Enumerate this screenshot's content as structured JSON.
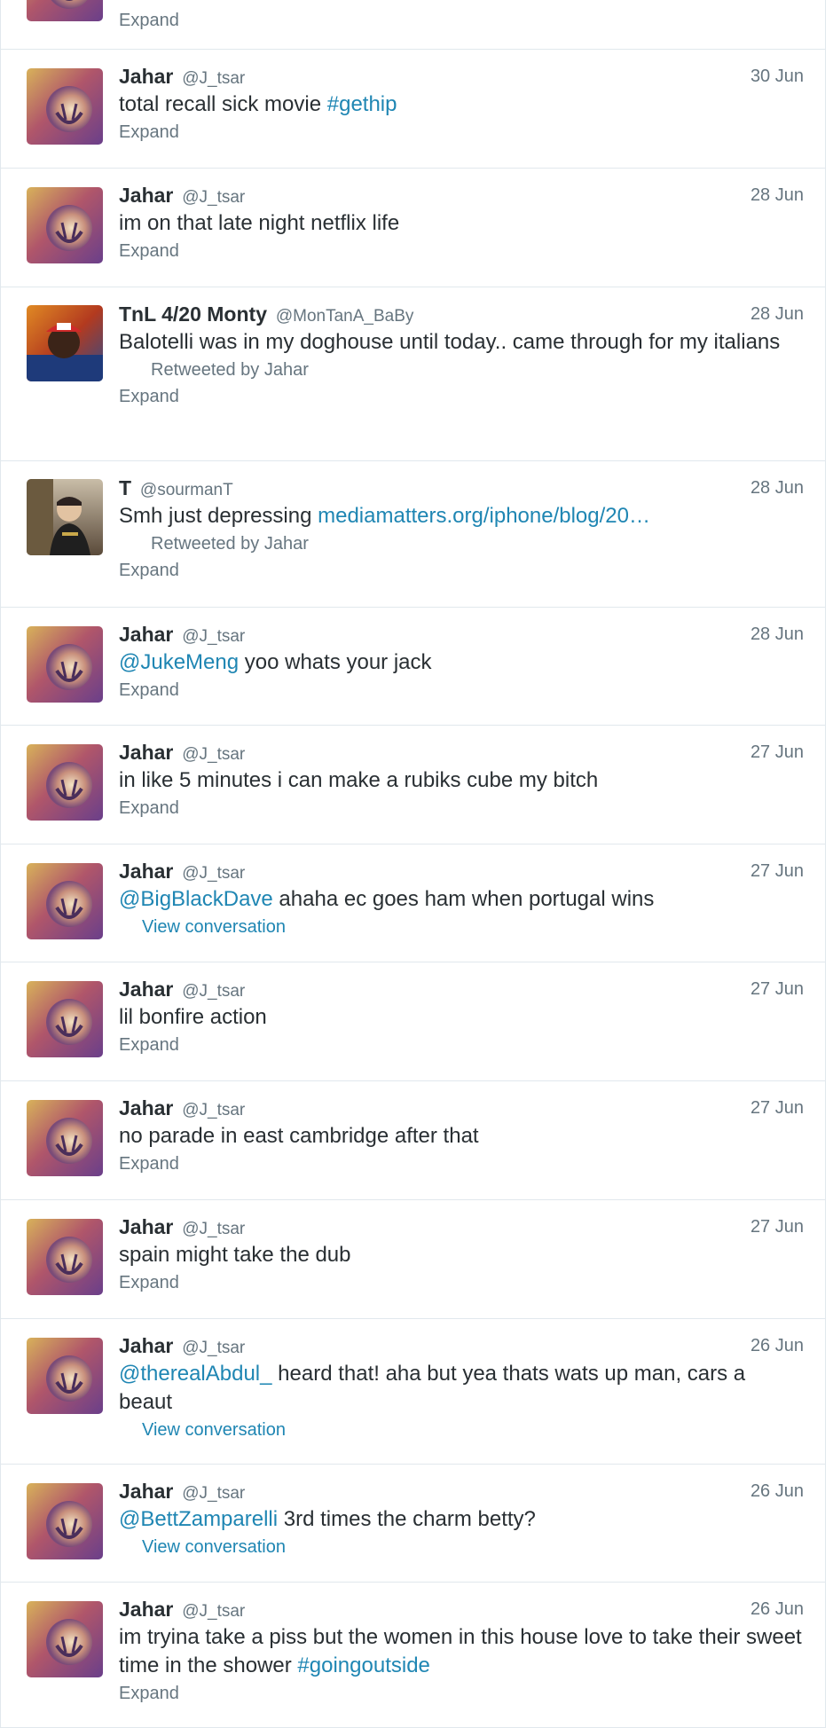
{
  "colors": {
    "link": "#1f86b3",
    "meta": "#66757f",
    "name": "#292f33",
    "border": "#e1e8ed"
  },
  "top_partial": {
    "action": "Expand"
  },
  "tweets": [
    {
      "name": "Jahar",
      "handle": "@J_tsar",
      "time": "30 Jun",
      "text_before": "total recall sick movie ",
      "link": "#gethip",
      "text_after": "",
      "action": "Expand"
    },
    {
      "name": "Jahar",
      "handle": "@J_tsar",
      "time": "28 Jun",
      "text_before": "im on that late night netflix life",
      "link": "",
      "text_after": "",
      "action": "Expand"
    },
    {
      "name": "TnL 4/20 Monty",
      "handle": "@MonTanA_BaBy",
      "time": "28 Jun",
      "text_before": "Balotelli was in my doghouse until today.. came through for my italians",
      "link": "",
      "text_after": "",
      "retweet": "Retweeted by Jahar",
      "action": "Expand"
    },
    {
      "name": "T",
      "handle": "@sourmanT",
      "time": "28 Jun",
      "text_before": "Smh just depressing ",
      "link": "mediamatters.org/iphone/blog/20…",
      "text_after": "",
      "retweet": "Retweeted by Jahar",
      "action": "Expand"
    },
    {
      "name": "Jahar",
      "handle": "@J_tsar",
      "time": "28 Jun",
      "text_before": "",
      "link": "@JukeMeng",
      "text_after": " yoo whats your jack",
      "action": "Expand"
    },
    {
      "name": "Jahar",
      "handle": "@J_tsar",
      "time": "27 Jun",
      "text_before": "in like 5 minutes i can make a rubiks cube my bitch",
      "link": "",
      "text_after": "",
      "action": "Expand"
    },
    {
      "name": "Jahar",
      "handle": "@J_tsar",
      "time": "27 Jun",
      "text_before": "",
      "link": "@BigBlackDave",
      "text_after": " ahaha ec goes ham when portugal wins",
      "view": "View conversation"
    },
    {
      "name": "Jahar",
      "handle": "@J_tsar",
      "time": "27 Jun",
      "text_before": "lil bonfire action",
      "link": "",
      "text_after": "",
      "action": "Expand"
    },
    {
      "name": "Jahar",
      "handle": "@J_tsar",
      "time": "27 Jun",
      "text_before": "no parade in east cambridge after that",
      "link": "",
      "text_after": "",
      "action": "Expand"
    },
    {
      "name": "Jahar",
      "handle": "@J_tsar",
      "time": "27 Jun",
      "text_before": "spain might take the dub",
      "link": "",
      "text_after": "",
      "action": "Expand"
    },
    {
      "name": "Jahar",
      "handle": "@J_tsar",
      "time": "26 Jun",
      "text_before": "",
      "link": "@therealAbdul_",
      "text_after": " heard that! aha but yea thats wats up man, cars a beaut",
      "view": "View conversation"
    },
    {
      "name": "Jahar",
      "handle": "@J_tsar",
      "time": "26 Jun",
      "text_before": "",
      "link": "@BettZamparelli",
      "text_after": " 3rd times the charm betty?",
      "view": "View conversation"
    },
    {
      "name": "Jahar",
      "handle": "@J_tsar",
      "time": "26 Jun",
      "text_before": "im tryina take a piss but the women in this house love to take their sweet time in the shower ",
      "link": "#goingoutside",
      "text_after": "",
      "action": "Expand"
    }
  ]
}
